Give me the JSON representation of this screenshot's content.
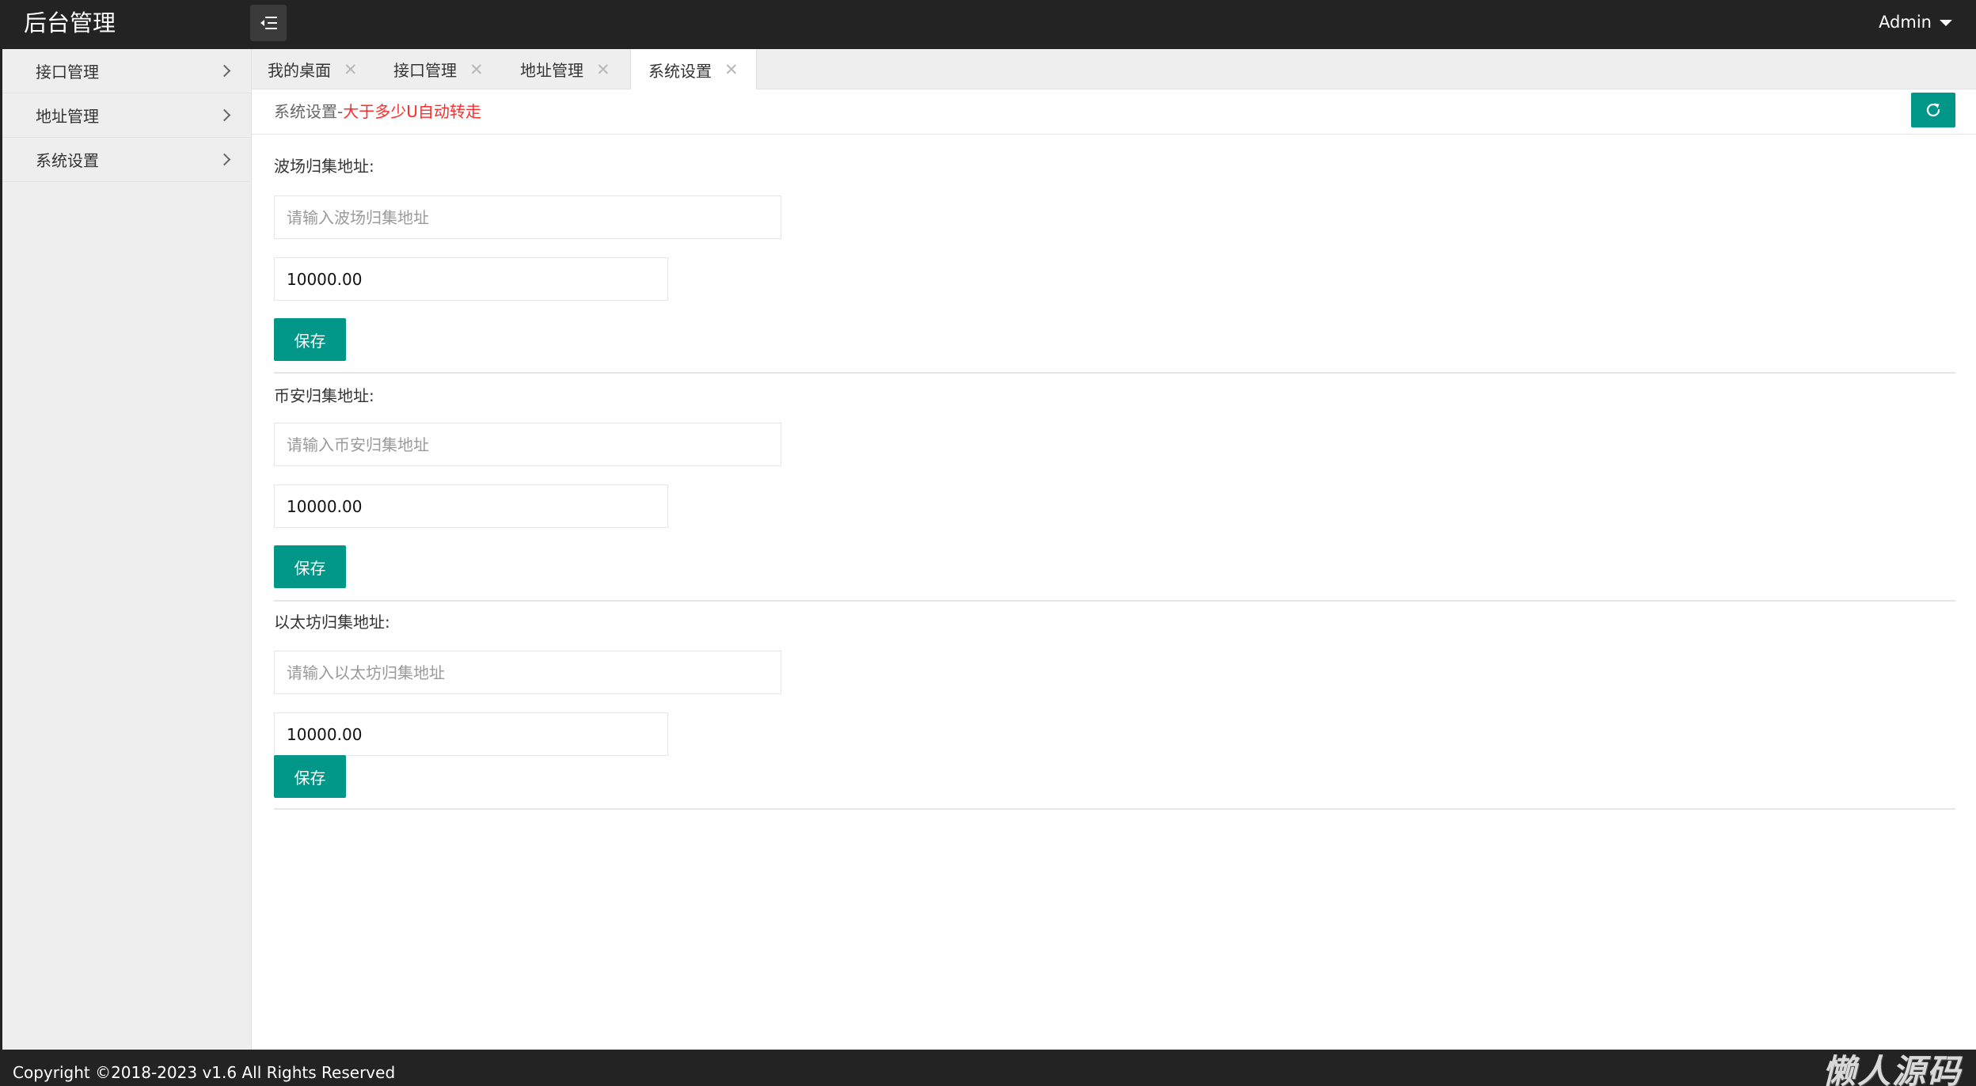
{
  "header": {
    "brand": "后台管理",
    "user": "Admin"
  },
  "sidebar": {
    "items": [
      {
        "label": "接口管理"
      },
      {
        "label": "地址管理"
      },
      {
        "label": "系统设置"
      }
    ]
  },
  "tabs": [
    {
      "label": "我的桌面"
    },
    {
      "label": "接口管理"
    },
    {
      "label": "地址管理"
    },
    {
      "label": "系统设置",
      "active": true
    }
  ],
  "breadcrumb": {
    "prefix": "系统设置-",
    "highlight": "大于多少U自动转走"
  },
  "sections": [
    {
      "label": "波场归集地址:",
      "address_placeholder": "请输入波场归集地址",
      "address_value": "",
      "amount": "10000.00",
      "save_label": "保存"
    },
    {
      "label": "币安归集地址:",
      "address_placeholder": "请输入币安归集地址",
      "address_value": "",
      "amount": "10000.00",
      "save_label": "保存"
    },
    {
      "label": "以太坊归集地址:",
      "address_placeholder": "请输入以太坊归集地址",
      "address_value": "",
      "amount": "10000.00",
      "save_label": "保存"
    }
  ],
  "footer": {
    "copyright": "Copyright ©2018-2023 v1.6 All Rights Reserved",
    "watermark": "懒人源码"
  },
  "colors": {
    "topbar": "#232323",
    "accent": "#009688",
    "highlight": "#ff2a2a",
    "sidebar_bg": "#eeeeee"
  },
  "icons": {
    "menu_toggle": "menu-fold-icon",
    "refresh": "refresh-icon",
    "tab_close": "close-icon",
    "nav_arrow": "chevron-right-icon",
    "user_dropdown": "caret-down-icon"
  }
}
